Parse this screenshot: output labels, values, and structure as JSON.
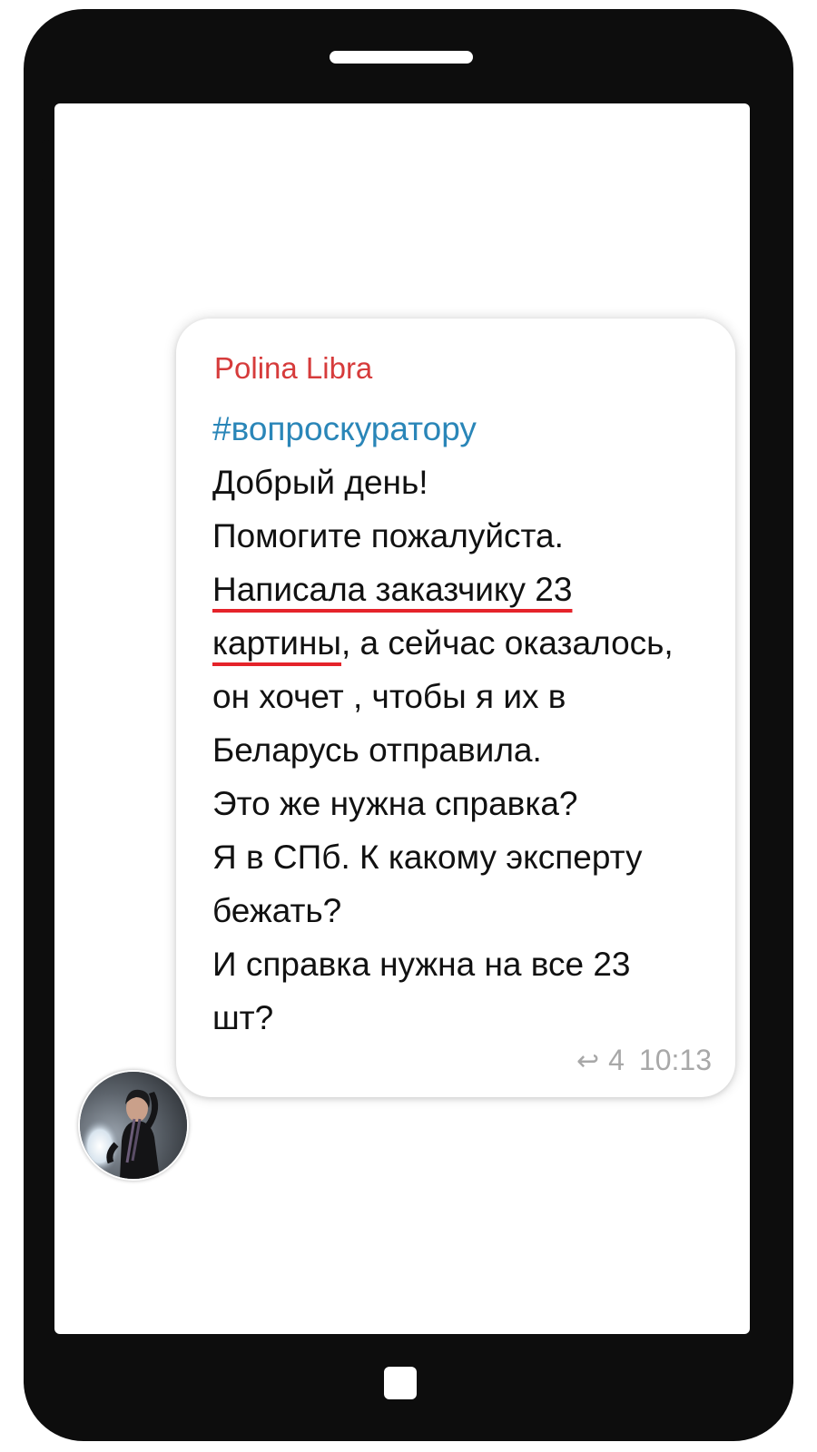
{
  "message": {
    "sender": "Polina Libra",
    "hashtag": "#вопроскуратору",
    "lines": [
      "Добрый день!",
      "Помогите пожалуйста.",
      "Написала заказчику 23",
      "картины",
      ", а сейчас оказалось,",
      "он хочет , чтобы я их в",
      "Беларусь отправила.",
      "Это же нужна справка?",
      "Я в СПб. К какому эксперту",
      "бежать?",
      "И  справка нужна на все 23",
      "шт?"
    ],
    "reply_count": "4",
    "time": "10:13"
  },
  "colors": {
    "sender": "#d63b3b",
    "hashtag": "#2a86b8",
    "underline": "#e5232a",
    "meta": "#a8a8a8",
    "phone": "#0d0d0d"
  },
  "icons": {
    "reply": "reply-arrow-icon"
  }
}
